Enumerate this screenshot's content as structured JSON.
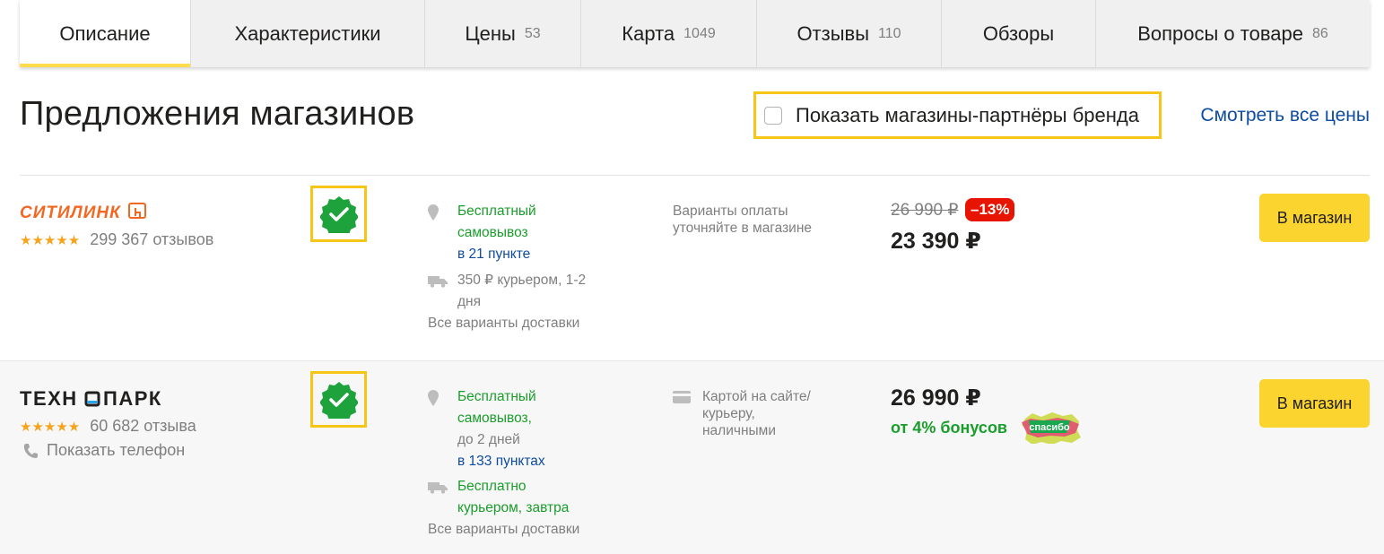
{
  "tabs": [
    {
      "label": "Описание",
      "count": "",
      "active": true,
      "width": 191
    },
    {
      "label": "Характеристики",
      "count": "",
      "active": false,
      "width": 261
    },
    {
      "label": "Цены",
      "count": "53",
      "active": false,
      "width": 174
    },
    {
      "label": "Карта",
      "count": "1049",
      "active": false,
      "width": 196
    },
    {
      "label": "Отзывы",
      "count": "110",
      "active": false,
      "width": 206
    },
    {
      "label": "Обзоры",
      "count": "",
      "active": false,
      "width": 172
    },
    {
      "label": "Вопросы о товаре",
      "count": "86",
      "active": false,
      "width": 305
    }
  ],
  "header": {
    "title": "Предложения магазинов",
    "partners_label": "Показать магазины-партнёры бренда",
    "partners_checked": false,
    "all_prices": "Смотреть все цены"
  },
  "offers": [
    {
      "shop": "СИТИЛИНК",
      "reviews": "299 367 отзывов",
      "stars": "★★★★★",
      "pickup_line1": "Бесплатный",
      "pickup_line2": "самовывоз",
      "pickup_points": "в 21 пункте",
      "courier_line1": "350 ₽ курьером, 1-2",
      "courier_line2": "дня",
      "all_delivery": "Все варианты доставки",
      "payment_line1": "Варианты оплаты",
      "payment_line2": "уточняйте в магазине",
      "old_price": "26 990 ₽",
      "discount": "–13%",
      "price": "23 390 ₽",
      "button": "В магазин"
    },
    {
      "shop": "ТЕХНОПАРК",
      "reviews": "60 682 отзыва",
      "stars": "★★★★★",
      "phone": "Показать телефон",
      "pickup_line1": "Бесплатный",
      "pickup_line2": "самовывоз,",
      "pickup_line3": "до 2 дней",
      "pickup_points": "в 133 пунктах",
      "courier_line1": "Бесплатно",
      "courier_line2": "курьером, завтра",
      "all_delivery": "Все варианты доставки",
      "payment_line1": "Картой на сайте/",
      "payment_line2": "курьеру,",
      "payment_line3": "наличными",
      "price": "26 990 ₽",
      "bonus": "от 4% бонусов",
      "bonus_logo": "спасибо",
      "button": "В магазин"
    }
  ],
  "colors": {
    "accent_yellow": "#fcd430",
    "highlight_border": "#f5c518",
    "green": "#1a9e2b",
    "link_blue": "#0e4ca1",
    "discount_red": "#e61400",
    "citilink_orange": "#f26722",
    "stars": "#f6a31d"
  }
}
